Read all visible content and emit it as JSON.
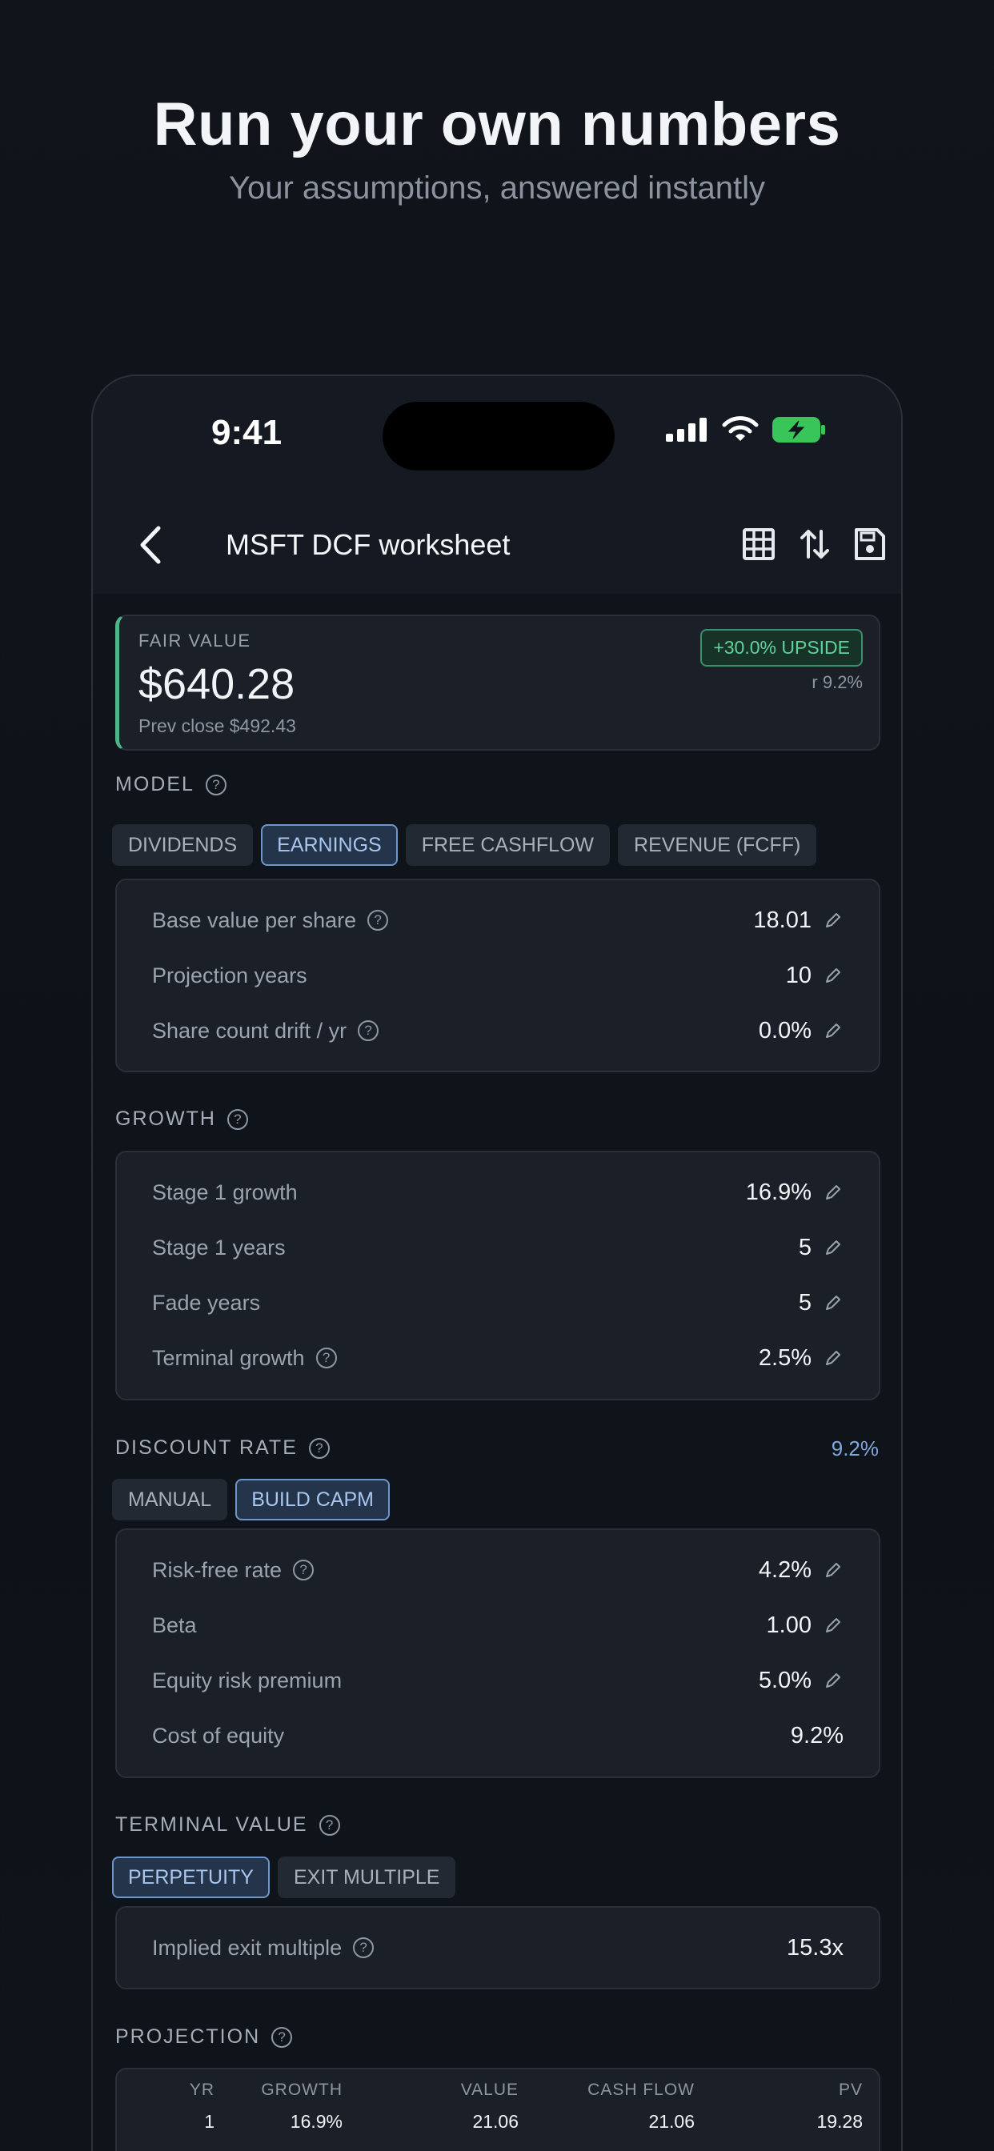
{
  "hero": {
    "title": "Run your own numbers",
    "subtitle": "Your assumptions, answered instantly"
  },
  "status_bar": {
    "time": "9:41"
  },
  "app_bar": {
    "title": "MSFT DCF worksheet"
  },
  "fair_value": {
    "label": "FAIR VALUE",
    "value": "$640.28",
    "prev_close": "Prev close $492.43",
    "upside_badge": "+30.0% UPSIDE",
    "rate": "r 9.2%"
  },
  "model": {
    "title": "MODEL",
    "tabs": [
      "DIVIDENDS",
      "EARNINGS",
      "FREE CASHFLOW",
      "REVENUE (FCFF)"
    ],
    "selected_tab": "EARNINGS",
    "rows": [
      {
        "label": "Base value per share",
        "value": "18.01"
      },
      {
        "label": "Projection years",
        "value": "10"
      },
      {
        "label": "Share count drift / yr",
        "value": "0.0%"
      }
    ]
  },
  "growth": {
    "title": "GROWTH",
    "rows": [
      {
        "label": "Stage 1 growth",
        "value": "16.9%"
      },
      {
        "label": "Stage 1 years",
        "value": "5"
      },
      {
        "label": "Fade years",
        "value": "5"
      },
      {
        "label": "Terminal growth",
        "value": "2.5%"
      }
    ]
  },
  "discount_rate": {
    "title": "DISCOUNT RATE",
    "value": "9.2%",
    "tabs": [
      "MANUAL",
      "BUILD CAPM"
    ],
    "selected_tab": "BUILD CAPM",
    "rows": [
      {
        "label": "Risk-free rate",
        "value": "4.2%"
      },
      {
        "label": "Beta",
        "value": "1.00"
      },
      {
        "label": "Equity risk premium",
        "value": "5.0%"
      },
      {
        "label": "Cost of equity",
        "value": "9.2%"
      }
    ]
  },
  "terminal_value": {
    "title": "TERMINAL VALUE",
    "tabs": [
      "PERPETUITY",
      "EXIT MULTIPLE"
    ],
    "selected_tab": "PERPETUITY",
    "rows": [
      {
        "label": "Implied exit multiple",
        "value": "15.3x"
      }
    ]
  },
  "projection": {
    "title": "PROJECTION",
    "columns": [
      "YR",
      "GROWTH",
      "VALUE",
      "CASH FLOW",
      "PV"
    ],
    "rows": [
      [
        "1",
        "16.9%",
        "21.06",
        "21.06",
        "19.28"
      ]
    ]
  },
  "colors": {
    "accent_green": "#5fd39c",
    "accent_blue": "#7ea8e0",
    "background": "#0f131a",
    "card": "#1a1f28"
  },
  "icons": [
    "back-chevron-icon",
    "grid-icon",
    "sort-arrows-icon",
    "save-icon",
    "help-icon",
    "pencil-icon",
    "signal-icon",
    "wifi-icon",
    "battery-charging-icon"
  ]
}
